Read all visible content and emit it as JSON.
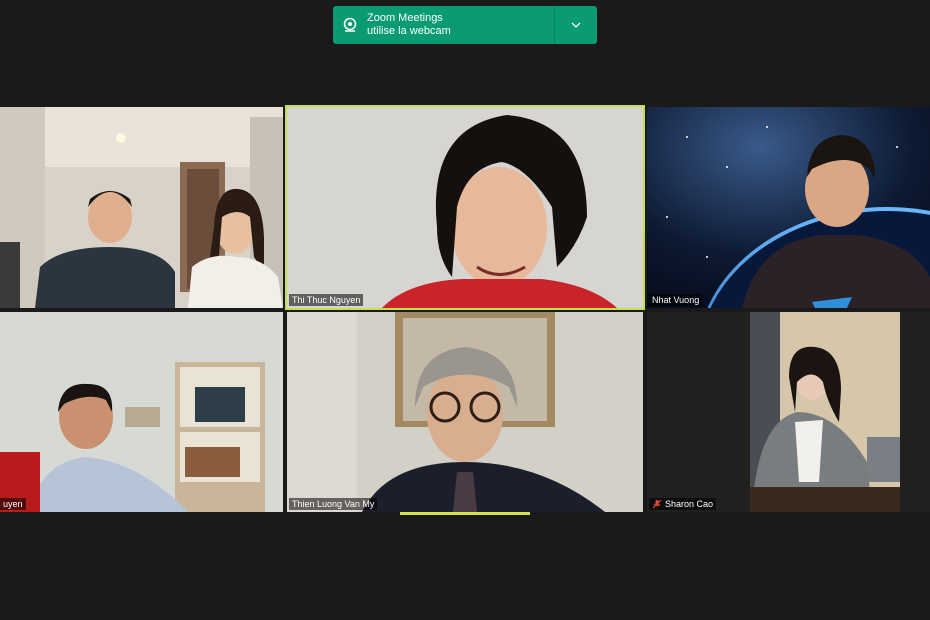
{
  "notification": {
    "line1": "Zoom Meetings",
    "line2": "utilise la webcam",
    "icon": "webcam-icon",
    "expand_icon": "chevron-down-icon",
    "bg": "#0a9b73"
  },
  "participants": [
    {
      "name": "",
      "active": false
    },
    {
      "name": "Thi Thuc Nguyen",
      "active": true
    },
    {
      "name": "Nhat Vuong",
      "active": false
    },
    {
      "name": "uyen",
      "active": false
    },
    {
      "name": "Thien Luong Van My",
      "active": false
    },
    {
      "name": "Sharon Cao",
      "active": false,
      "muted": true
    }
  ],
  "colors": {
    "active_border": "#c5e04f",
    "background": "#1a1a1a"
  }
}
